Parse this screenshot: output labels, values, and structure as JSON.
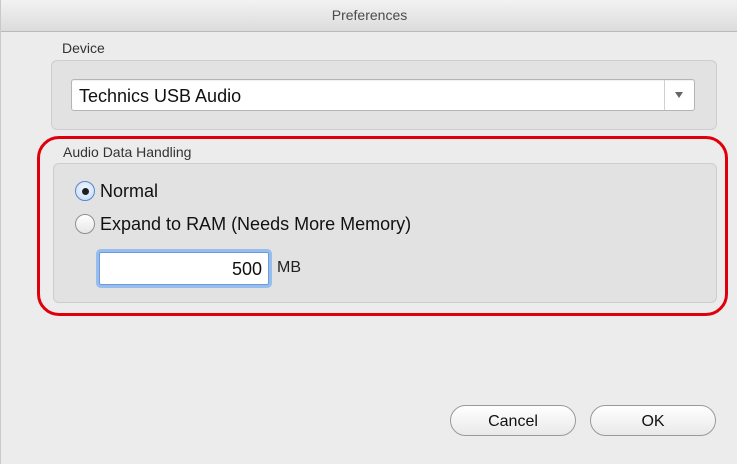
{
  "window": {
    "title": "Preferences"
  },
  "device": {
    "group_label": "Device",
    "selected": "Technics USB Audio"
  },
  "audio": {
    "group_label": "Audio Data Handling",
    "options": [
      {
        "label": "Normal",
        "checked": true
      },
      {
        "label": "Expand to RAM (Needs More Memory)",
        "checked": false
      }
    ],
    "memory_value": "500",
    "memory_unit": "MB"
  },
  "buttons": {
    "cancel": "Cancel",
    "ok": "OK"
  },
  "annotation": {
    "color": "#e0000c"
  }
}
